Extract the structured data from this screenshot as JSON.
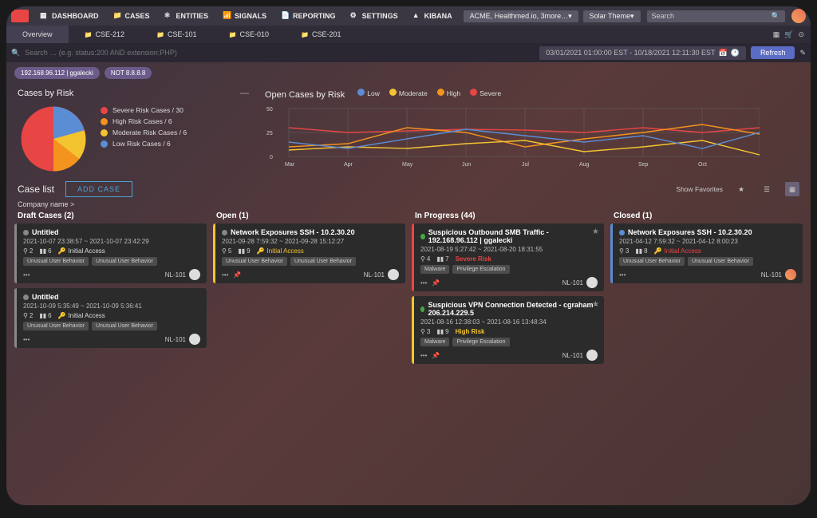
{
  "topnav": {
    "dashboard": "DASHBOARD",
    "cases": "CASES",
    "entities": "ENTITIES",
    "signals": "SIGNALS",
    "reporting": "REPORTING",
    "settings": "SETTINGS",
    "kibana": "KIBANA",
    "tenant": "ACME, Healthmed.io, 3more…",
    "theme": "Solar Theme",
    "search_placeholder": "Search"
  },
  "tabs": [
    "Overview",
    "CSE-212",
    "CSE-101",
    "CSE-010",
    "CSE-201"
  ],
  "search": {
    "placeholder": "Search … (e.g. status:200 AND extension:PHP)",
    "daterange": "03/01/2021 01:00:00 EST - 10/18/2021 12:11:30 EST",
    "refresh": "Refresh"
  },
  "chips": [
    "192.168.96.112 | ggalecki",
    "NOT 8.8.8.8"
  ],
  "chart_data": [
    {
      "type": "pie",
      "title": "Cases by Risk",
      "values": [
        30,
        6,
        6,
        6
      ],
      "labels": [
        "Severe Risk Cases",
        "High Risk Cases",
        "Moderate Risk Cases",
        "Low Risk Cases"
      ],
      "colors": [
        "#e84545",
        "#f4931e",
        "#f4c430",
        "#5b8dd4"
      ],
      "legend": [
        "Severe Risk Cases / 30",
        "High Risk Cases / 6",
        "Moderate Risk Cases / 6",
        "Low Risk Cases / 6"
      ]
    },
    {
      "type": "line",
      "title": "Open Cases by Risk",
      "categories": [
        "Mar",
        "Apr",
        "May",
        "Jun",
        "Jul",
        "Aug",
        "Sep",
        "Oct"
      ],
      "legend_labels": [
        "Low",
        "Moderate",
        "High",
        "Severe"
      ],
      "ylim": [
        0,
        50
      ],
      "yticks": [
        0,
        25,
        50
      ],
      "series": [
        {
          "name": "Low",
          "color": "#5b8dd4",
          "values": [
            15,
            8,
            18,
            28,
            22,
            15,
            22,
            25
          ]
        },
        {
          "name": "Moderate",
          "color": "#f4c430",
          "values": [
            7,
            10,
            8,
            13,
            17,
            5,
            10,
            2
          ]
        },
        {
          "name": "High",
          "color": "#f4931e",
          "values": [
            10,
            13,
            30,
            25,
            10,
            18,
            25,
            23
          ]
        },
        {
          "name": "Severe",
          "color": "#e84545",
          "values": [
            30,
            25,
            27,
            28,
            27,
            25,
            30,
            30
          ]
        }
      ]
    }
  ],
  "caselist": {
    "title": "Case list",
    "add": "ADD CASE",
    "showfav": "Show\nFavorites",
    "company": "Company name"
  },
  "cols": {
    "draft": {
      "title": "Draft Cases (2)",
      "cards": [
        {
          "title": "Untitled",
          "dates": "2021-10-07  23:38:57 ~ 2021-10-07  23:42:29",
          "s1": "2",
          "s2": "6",
          "access": "Initial Access",
          "tags": [
            "Unusual User Behavior",
            "Unusual User Behavior"
          ],
          "id": "NL-101"
        },
        {
          "title": "Untitled",
          "dates": "2021-10-09  5:35:49 ~ 2021-10-09  5:36:41",
          "s1": "2",
          "s2": "6",
          "access": "Initial Access",
          "tags": [
            "Unusual User Behavior",
            "Unusual User Behavior"
          ],
          "id": "NL-101"
        }
      ]
    },
    "open": {
      "title": "Open (1)",
      "cards": [
        {
          "title": "Network Exposures SSH - 10.2.30.20",
          "dates": "2021-09-28  7:59:32 ~ 2021-09-28  15:12:27",
          "s1": "5",
          "s2": "9",
          "access": "Initial Access",
          "tags": [
            "Unusual User Behavior",
            "Unusual User Behavior"
          ],
          "id": "NL-101"
        }
      ]
    },
    "inprogress": {
      "title": "In Progress (44)",
      "cards": [
        {
          "title": "Suspicious Outbound SMB Traffic - 192.168.96.112 | ggalecki",
          "dates": "2021-08-19  5:27:42 ~ 2021-08-20  18:31:55",
          "s1": "4",
          "s2": "7",
          "risk": "Severe Risk",
          "tags": [
            "Malware",
            "Privilege Escalation"
          ],
          "id": "NL-101"
        },
        {
          "title": "Suspicious VPN Connection Detected - cgraham - 206.214.229.5",
          "dates": "2021-08-16  12:38:03 ~ 2021-08-16  13:48:34",
          "s1": "3",
          "s2": "9",
          "risk": "High Risk",
          "tags": [
            "Malware",
            "Privilege Escalation"
          ],
          "id": "NL-101"
        }
      ]
    },
    "closed": {
      "title": "Closed (1)",
      "cards": [
        {
          "title": "Network Exposures SSH - 10.2.30.20",
          "dates": "2021-04-12  7:59:32 ~ 2021-04-12  8:00:23",
          "s1": "3",
          "s2": "8",
          "access": "Initial Access",
          "tags": [
            "Unusual User Behavior",
            "Unusual User Behavior"
          ],
          "id": "NL-101"
        }
      ]
    }
  }
}
